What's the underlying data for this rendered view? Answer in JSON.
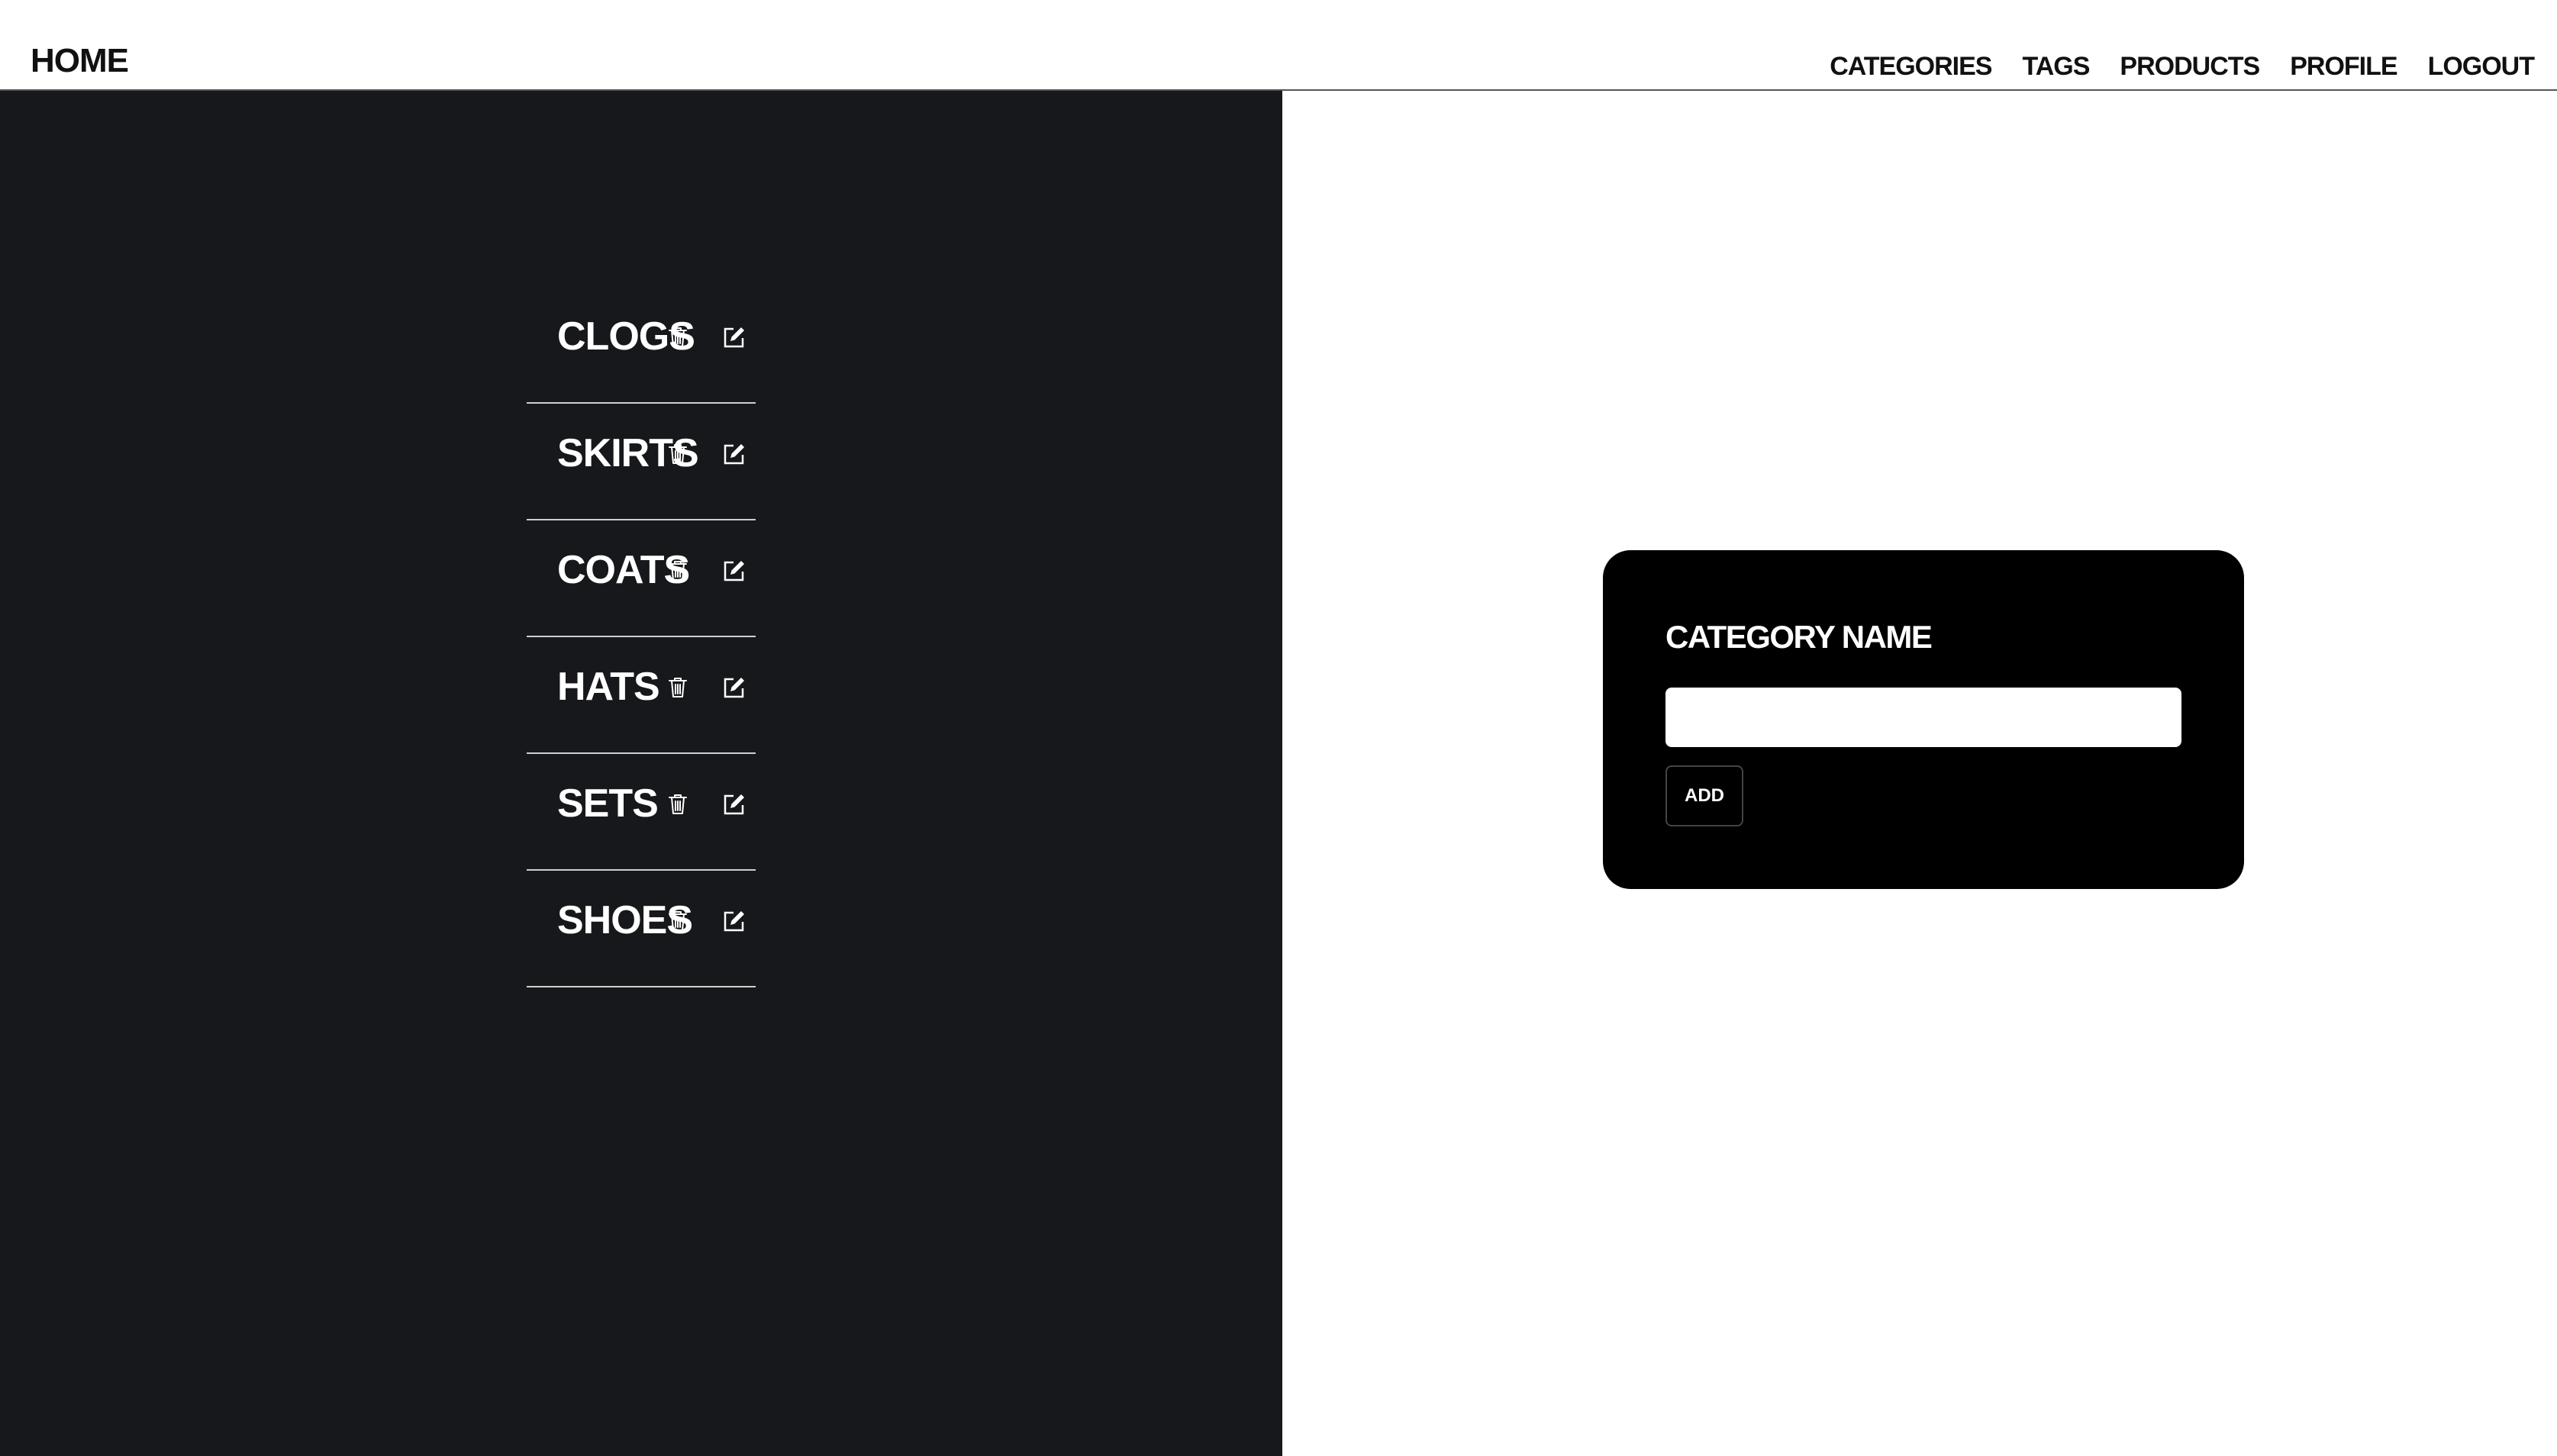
{
  "header": {
    "brand": "HOME",
    "nav": [
      "CATEGORIES",
      "TAGS",
      "PRODUCTS",
      "PROFILE",
      "LOGOUT"
    ]
  },
  "categories": [
    {
      "name": "CLOGS"
    },
    {
      "name": "SKIRTS"
    },
    {
      "name": "COATS"
    },
    {
      "name": "HATS"
    },
    {
      "name": "SETS"
    },
    {
      "name": "SHOES"
    }
  ],
  "icons": {
    "delete": "trash-icon",
    "edit": "edit-icon"
  },
  "form": {
    "label": "CATEGORY NAME",
    "input_value": "",
    "add_label": "ADD"
  },
  "colors": {
    "left_panel_bg": "#17181b",
    "card_bg": "#000000",
    "text_light": "#ffffff",
    "text_dark": "#111111"
  }
}
